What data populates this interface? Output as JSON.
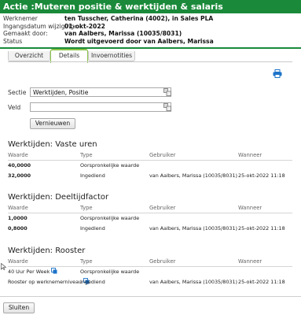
{
  "window": {
    "title": "Actie :Muteren positie & werktijden & salaris"
  },
  "info": [
    {
      "label": "Werknemer",
      "value": "ten Tusscher, Catherina (4002), in Sales PLA"
    },
    {
      "label": "Ingangsdatum wijziging:",
      "value": "01-okt-2022"
    },
    {
      "label": "Gemaakt door:",
      "value": "van Aalbers, Marissa (10035/8031)"
    },
    {
      "label": "Status",
      "value": "Wordt uitgevoerd door van Aalbers, Marissa"
    }
  ],
  "tabs": [
    {
      "label": "Overzicht"
    },
    {
      "label": "Details",
      "active": true
    },
    {
      "label": "Invoernotities"
    }
  ],
  "form": {
    "sectie_label": "Sectie",
    "sectie_value": "Werktijden, Positie",
    "veld_label": "Veld",
    "veld_value": "",
    "refresh_label": "Vernieuwen"
  },
  "columns": {
    "waarde": "Waarde",
    "type": "Type",
    "gebruiker": "Gebruiker",
    "wanneer": "Wanneer"
  },
  "sections": [
    {
      "title": "Werktijden: Vaste uren",
      "rows": [
        {
          "waarde": "40,0000",
          "type": "Oorspronkelijke waarde",
          "gebruiker": "",
          "wanneer": ""
        },
        {
          "waarde": "32,0000",
          "type": "Ingediend",
          "gebruiker": "van Aalbers, Marissa (10035/8031)",
          "wanneer": "25-okt-2022 11:18"
        }
      ]
    },
    {
      "title": "Werktijden: Deeltijdfactor",
      "rows": [
        {
          "waarde": "1,0000",
          "type": "Oorspronkelijke waarde",
          "gebruiker": "",
          "wanneer": ""
        },
        {
          "waarde": "0,8000",
          "type": "Ingediend",
          "gebruiker": "van Aalbers, Marissa (10035/8031)",
          "wanneer": "25-okt-2022 11:18"
        }
      ]
    },
    {
      "title": "Werktijden: Rooster",
      "rows": [
        {
          "waarde": "40 Uur Per Week",
          "type": "Oorspronkelijke waarde",
          "gebruiker": "",
          "wanneer": ""
        },
        {
          "waarde": "Rooster op werknemerniveau",
          "type": "Ingediend",
          "gebruiker": "van Aalbers, Marissa (10035/8031)",
          "wanneer": "25-okt-2022 11:18"
        }
      ]
    }
  ],
  "footer": {
    "close_label": "Sluiten"
  },
  "colors": {
    "title_bar": "#1a8a3a",
    "active_tab": "#8bc34a",
    "icon_blue": "#1e73c8"
  },
  "icons": {
    "print": "printer-icon",
    "lookup": "lookup-icon",
    "copy": "copy-icon"
  }
}
